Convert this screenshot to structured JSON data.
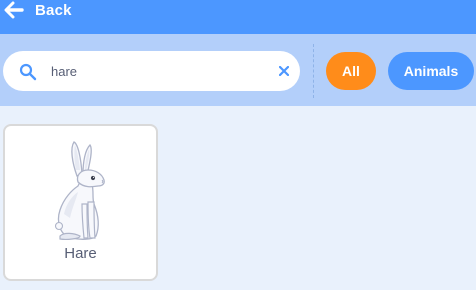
{
  "header": {
    "back_label": "Back",
    "back_icon": "left-arrow-icon"
  },
  "filter": {
    "search_value": "hare",
    "search_icon": "search-icon",
    "clear_icon": "close-icon",
    "chips": [
      {
        "label": "All",
        "active": true
      },
      {
        "label": "Animals",
        "active": false
      }
    ]
  },
  "results": [
    {
      "name": "Hare",
      "image": "hare-sprite"
    }
  ],
  "colors": {
    "header": "#4c97ff",
    "filterbar": "#b3cffa",
    "background": "#e9f1fc",
    "chip_active": "#ff8c1a",
    "chip_inactive": "#4c97ff",
    "text": "#575e75"
  }
}
